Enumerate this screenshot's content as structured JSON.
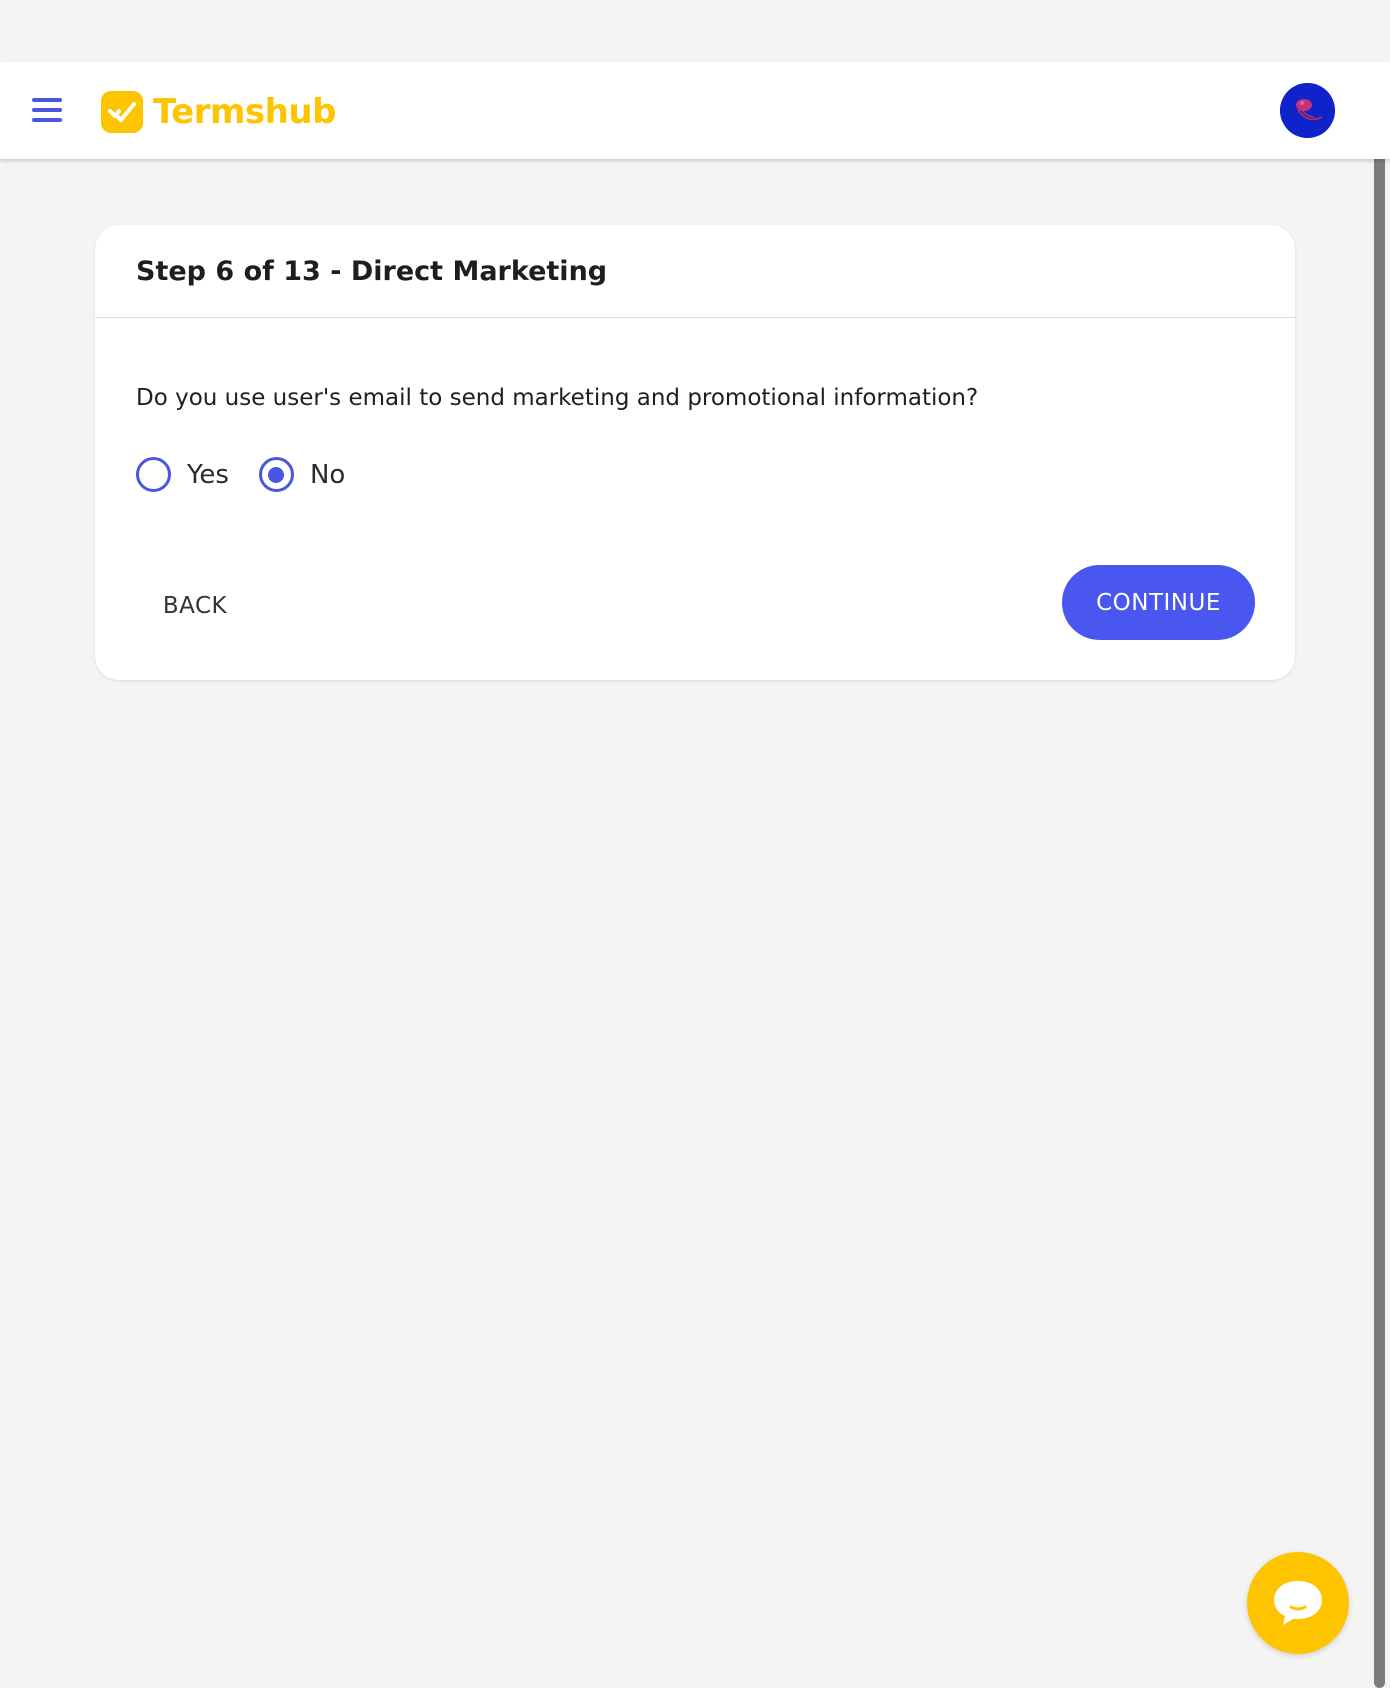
{
  "header": {
    "brand_name": "Termshub",
    "menu_icon": "hamburger-menu-icon",
    "logo_icon": "checkmark-logo-icon",
    "avatar_icon": "jellyfish-avatar-icon",
    "accent_color": "#ffc400",
    "primary_color": "#4a56e2"
  },
  "card": {
    "title": "Step 6 of 13 - Direct Marketing",
    "question": "Do you use user's email to send marketing and promotional information?",
    "options": [
      {
        "label": "Yes",
        "selected": false
      },
      {
        "label": "No",
        "selected": true
      }
    ],
    "back_label": "BACK",
    "continue_label": "CONTINUE"
  },
  "chat": {
    "icon": "chat-bubble-icon"
  }
}
